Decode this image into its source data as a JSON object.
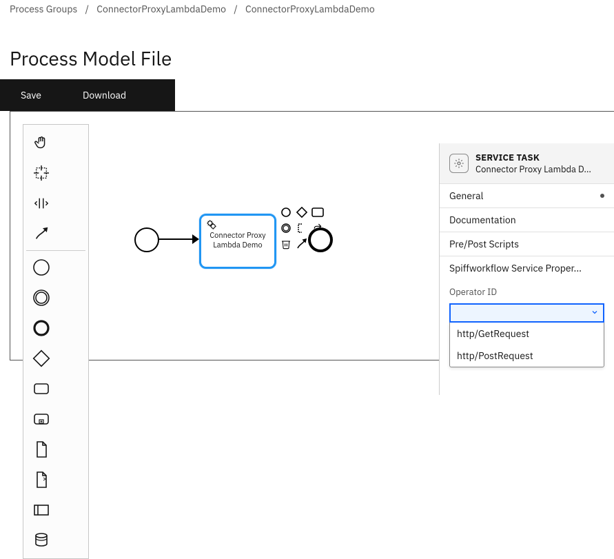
{
  "breadcrumb": {
    "root": "Process Groups",
    "group": "ConnectorProxyLambdaDemo",
    "model": "ConnectorProxyLambdaDemo"
  },
  "page_title": "Process Model File",
  "toolbar": {
    "save": "Save",
    "download": "Download"
  },
  "palette": {
    "tools": [
      "hand",
      "lasso",
      "space",
      "connect",
      "start-event",
      "intermediate-event",
      "end-event",
      "gateway",
      "task",
      "subprocess",
      "data-object",
      "data-object-ref",
      "participant",
      "data-store"
    ]
  },
  "diagram": {
    "service_task_label": "Connector Proxy Lambda Demo"
  },
  "context_pad": {
    "items": [
      "append-start",
      "append-gateway",
      "append-task",
      "append-intermediate",
      "annotation",
      "replace",
      "delete",
      "connect"
    ]
  },
  "props": {
    "type": "SERVICE TASK",
    "name": "Connector Proxy Lambda D...",
    "sections": [
      "General",
      "Documentation",
      "Pre/Post Scripts",
      "Spiffworkflow Service Proper..."
    ],
    "field_label": "Operator ID",
    "options": [
      "http/GetRequest",
      "http/PostRequest"
    ]
  }
}
